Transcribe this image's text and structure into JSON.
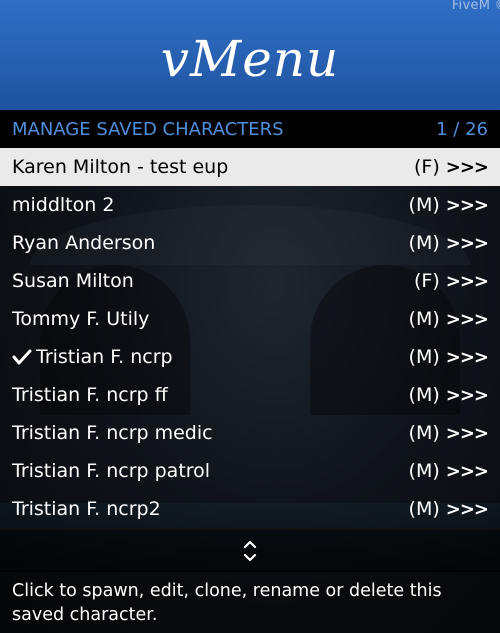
{
  "watermark": "FiveM ©",
  "menu": {
    "title": "vMenu",
    "subtitle": "MANAGE SAVED CHARACTERS",
    "counter": "1 / 26",
    "items": [
      {
        "name": "Karen Milton - test eup",
        "gender": "(F)",
        "arrow": ">>>",
        "selected": true,
        "checked": false
      },
      {
        "name": "middlton 2",
        "gender": "(M)",
        "arrow": ">>>",
        "selected": false,
        "checked": false
      },
      {
        "name": "Ryan Anderson",
        "gender": "(M)",
        "arrow": ">>>",
        "selected": false,
        "checked": false
      },
      {
        "name": "Susan Milton",
        "gender": "(F)",
        "arrow": ">>>",
        "selected": false,
        "checked": false
      },
      {
        "name": "Tommy F. Utily",
        "gender": "(M)",
        "arrow": ">>>",
        "selected": false,
        "checked": false
      },
      {
        "name": "Tristian F. ncrp",
        "gender": "(M)",
        "arrow": ">>>",
        "selected": false,
        "checked": true
      },
      {
        "name": "Tristian F. ncrp ff",
        "gender": "(M)",
        "arrow": ">>>",
        "selected": false,
        "checked": false
      },
      {
        "name": "Tristian F. ncrp medic",
        "gender": "(M)",
        "arrow": ">>>",
        "selected": false,
        "checked": false
      },
      {
        "name": "Tristian F. ncrp patrol",
        "gender": "(M)",
        "arrow": ">>>",
        "selected": false,
        "checked": false
      },
      {
        "name": "Tristian F. ncrp2",
        "gender": "(M)",
        "arrow": ">>>",
        "selected": false,
        "checked": false
      }
    ],
    "scroll_icon": "up-down-arrows-icon",
    "description": "Click to spawn, edit, clone, rename or delete this saved character."
  },
  "colors": {
    "banner": "#2f6ec6",
    "subtitle_text": "#4f8fdc",
    "selected_row": "#eaeaea"
  }
}
